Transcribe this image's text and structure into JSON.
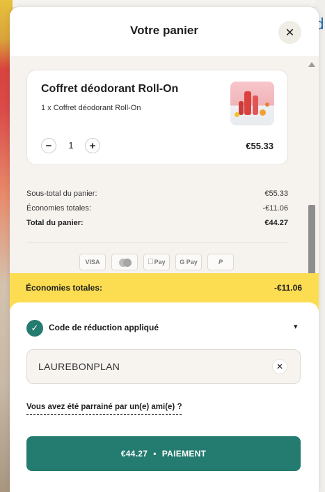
{
  "background": {
    "partial_text": "de"
  },
  "header": {
    "title": "Votre panier",
    "close_icon": "✕"
  },
  "product": {
    "name": "Coffret déodorant Roll-On",
    "line": "1 x Coffret déodorant Roll-On",
    "quantity": "1",
    "minus": "−",
    "plus": "+",
    "price": "€55.33"
  },
  "totals": [
    {
      "label": "Sous-total du panier:",
      "value": "€55.33",
      "bold": false
    },
    {
      "label": "Économies totales:",
      "value": "-€11.06",
      "bold": false
    },
    {
      "label": "Total du panier:",
      "value": "€44.27",
      "bold": true
    }
  ],
  "payment_methods": [
    "VISA",
    "mastercard",
    "Pay",
    "G Pay",
    "P"
  ],
  "savings_banner": {
    "label": "Économies totales:",
    "value": "-€11.06"
  },
  "promo": {
    "title": "Code de réduction appliqué",
    "check_icon": "✓",
    "chevron_icon": "⌄",
    "code": "LAUREBONPLAN",
    "clear_icon": "✕"
  },
  "referral_link": "Vous avez été parrainé par un(e) ami(e) ?",
  "checkout": {
    "amount": "€44.27",
    "separator": "•",
    "label": "PAIEMENT"
  },
  "colors": {
    "accent": "#247b6f",
    "banner": "#fcdd52"
  }
}
